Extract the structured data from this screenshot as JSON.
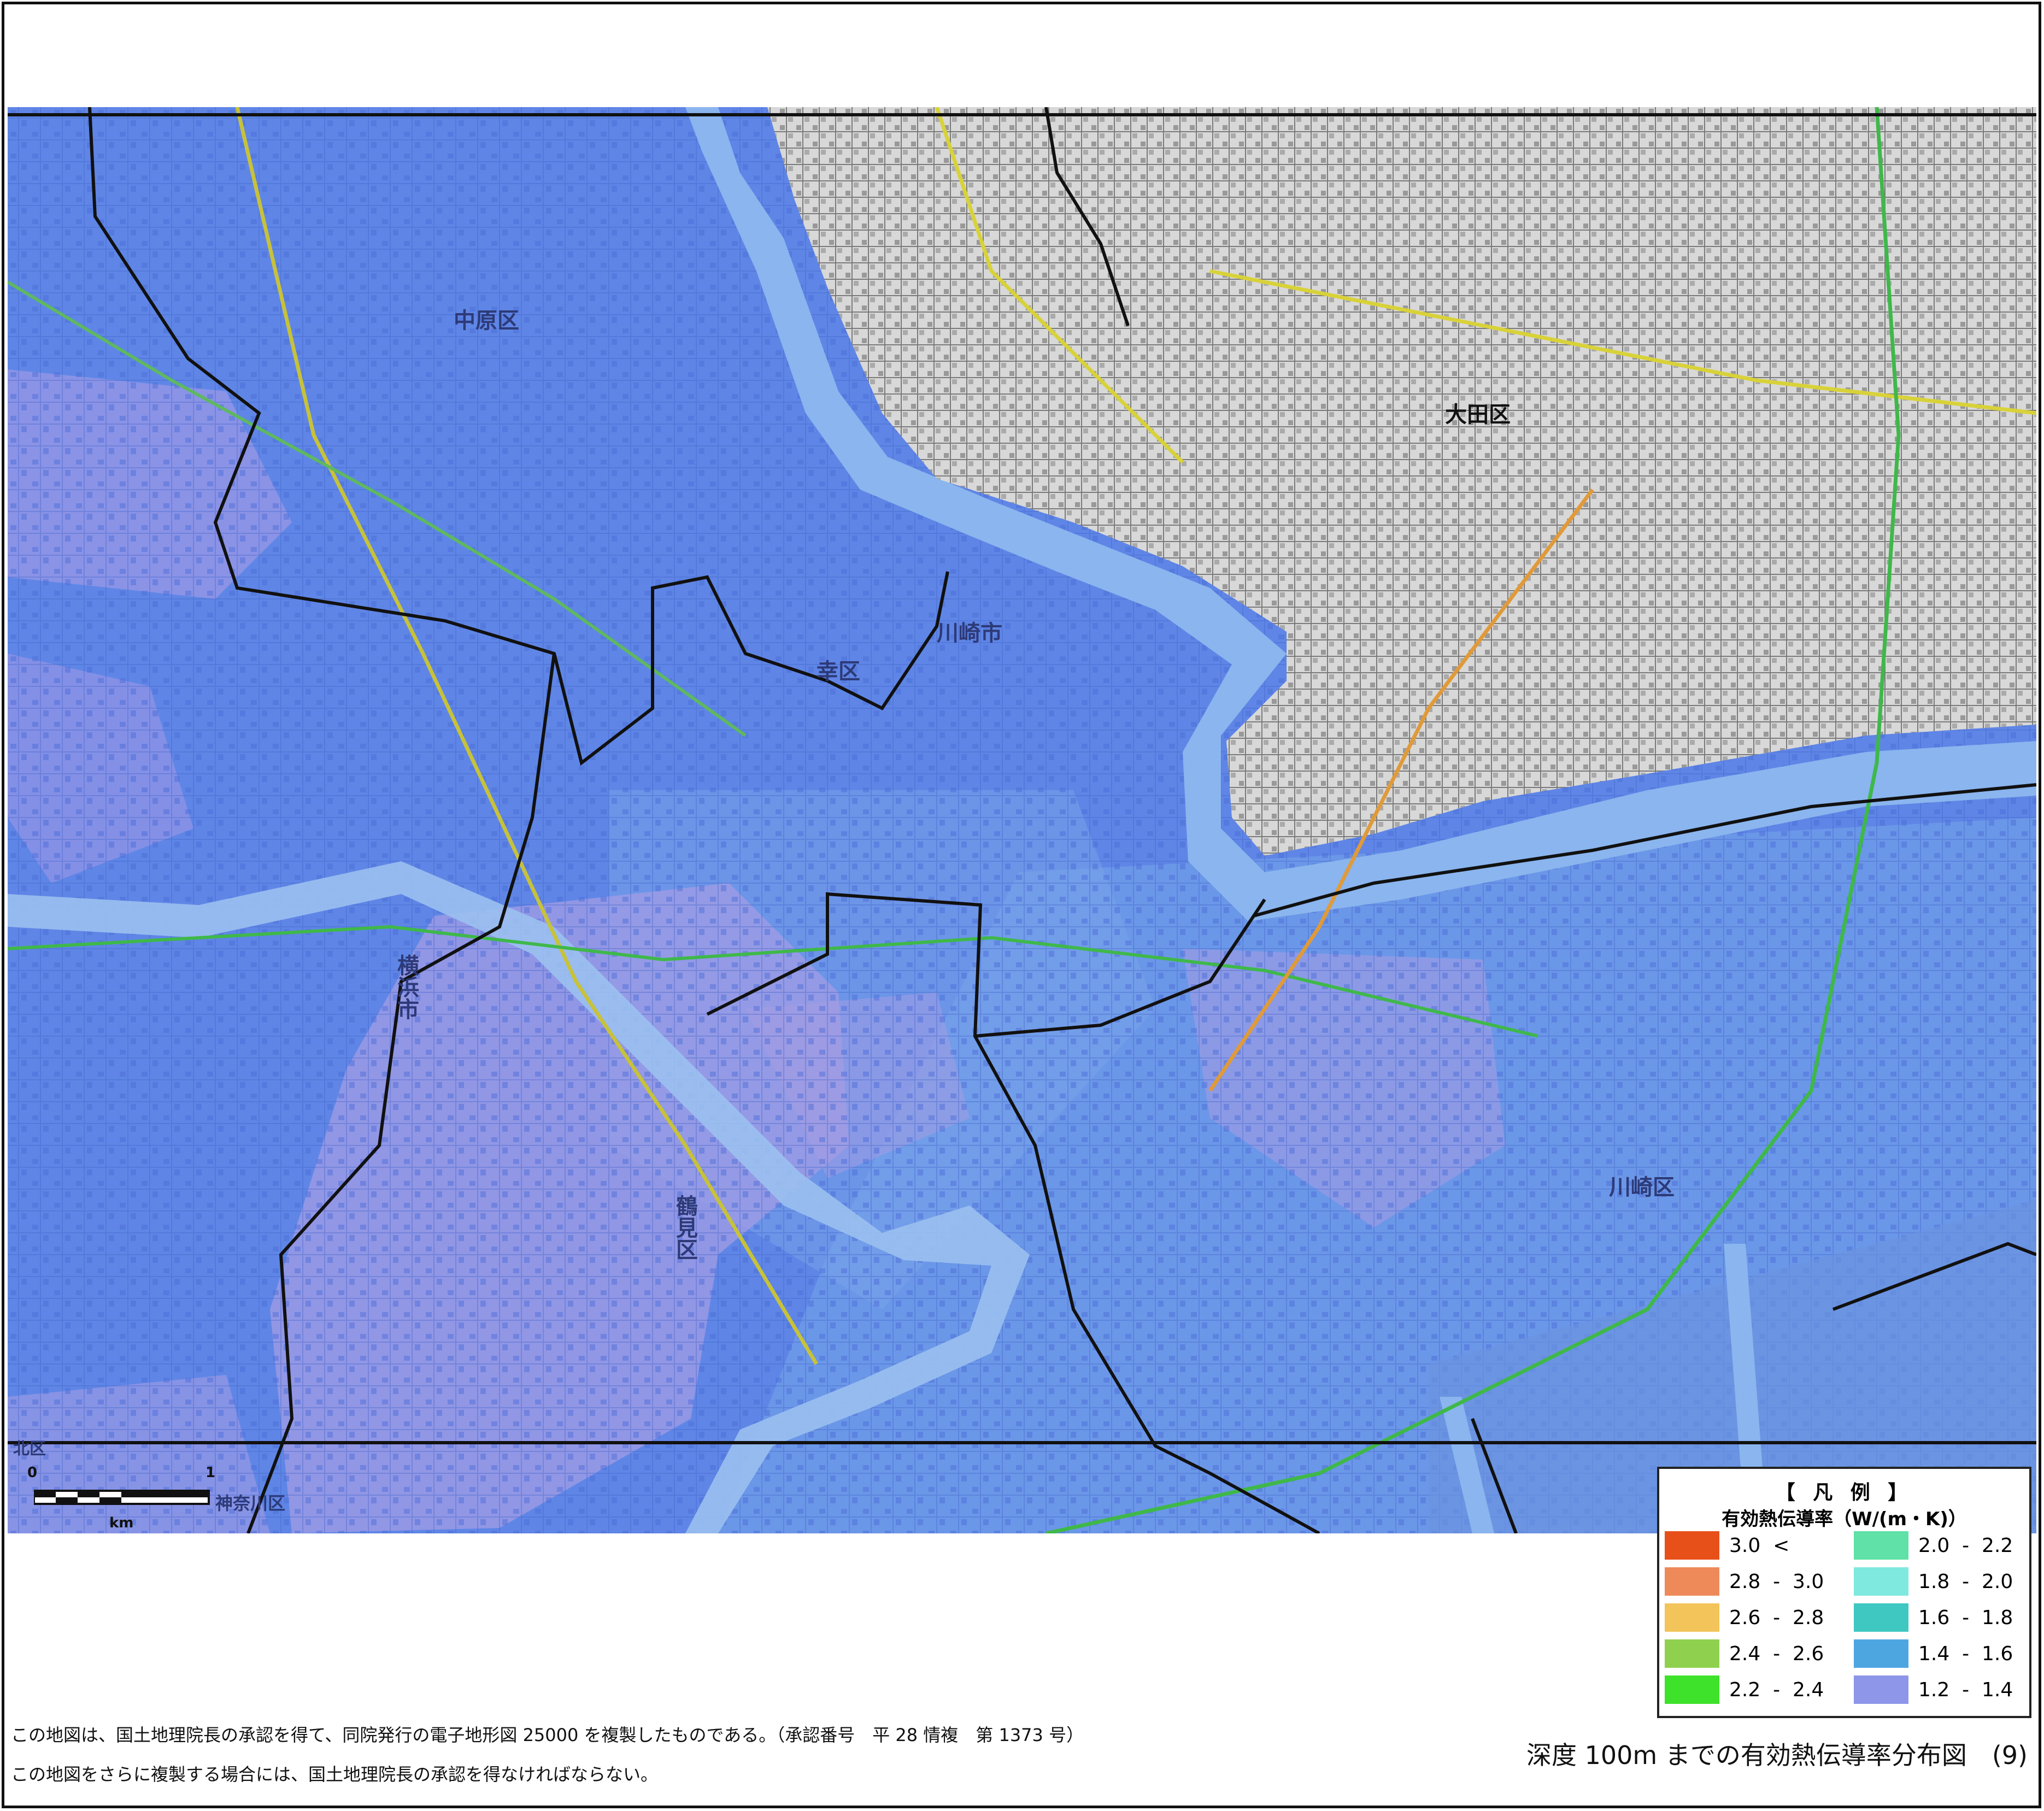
{
  "map": {
    "places": {
      "nakahara": "中原区",
      "saiwai": "幸区",
      "kawasaki_city": "川崎市",
      "ota": "大田区",
      "yokohama_city": "横浜市",
      "tsurumi": "鶴見区",
      "kawasaki_ward": "川崎区",
      "kanagawa": "神奈川区",
      "kita": "北区"
    },
    "scale": {
      "start": "0",
      "end": "1",
      "unit": "km"
    }
  },
  "legend": {
    "title": "【 凡 例 】",
    "subtitle": "有効熱伝導率（W/(m・K)）",
    "items": [
      {
        "label": "3.0  <",
        "color": "#e8501a"
      },
      {
        "label": "2.8  -  3.0",
        "color": "#ee8a5a"
      },
      {
        "label": "2.6  -  2.8",
        "color": "#f2c45a"
      },
      {
        "label": "2.4  -  2.6",
        "color": "#8fd14f"
      },
      {
        "label": "2.2  -  2.4",
        "color": "#3fe22a"
      },
      {
        "label": "2.0  -  2.2",
        "color": "#5fe1a7"
      },
      {
        "label": "1.8  -  2.0",
        "color": "#7fe9df"
      },
      {
        "label": "1.6  -  1.8",
        "color": "#3fc7c2"
      },
      {
        "label": "1.4  -  1.6",
        "color": "#4ea6e1"
      },
      {
        "label": "1.2  -  1.4",
        "color": "#8d96e8"
      }
    ]
  },
  "footer": {
    "note1": "この地図は、国土地理院長の承認を得て、同院発行の電子地形図 25000 を複製したものである。（承認番号　平 28 情複　第 1373 号）",
    "note2": "この地図をさらに複製する場合には、国土地理院長の承認を得なければならない。",
    "title": "深度 100m までの有効熱伝導率分布図　(9)"
  }
}
